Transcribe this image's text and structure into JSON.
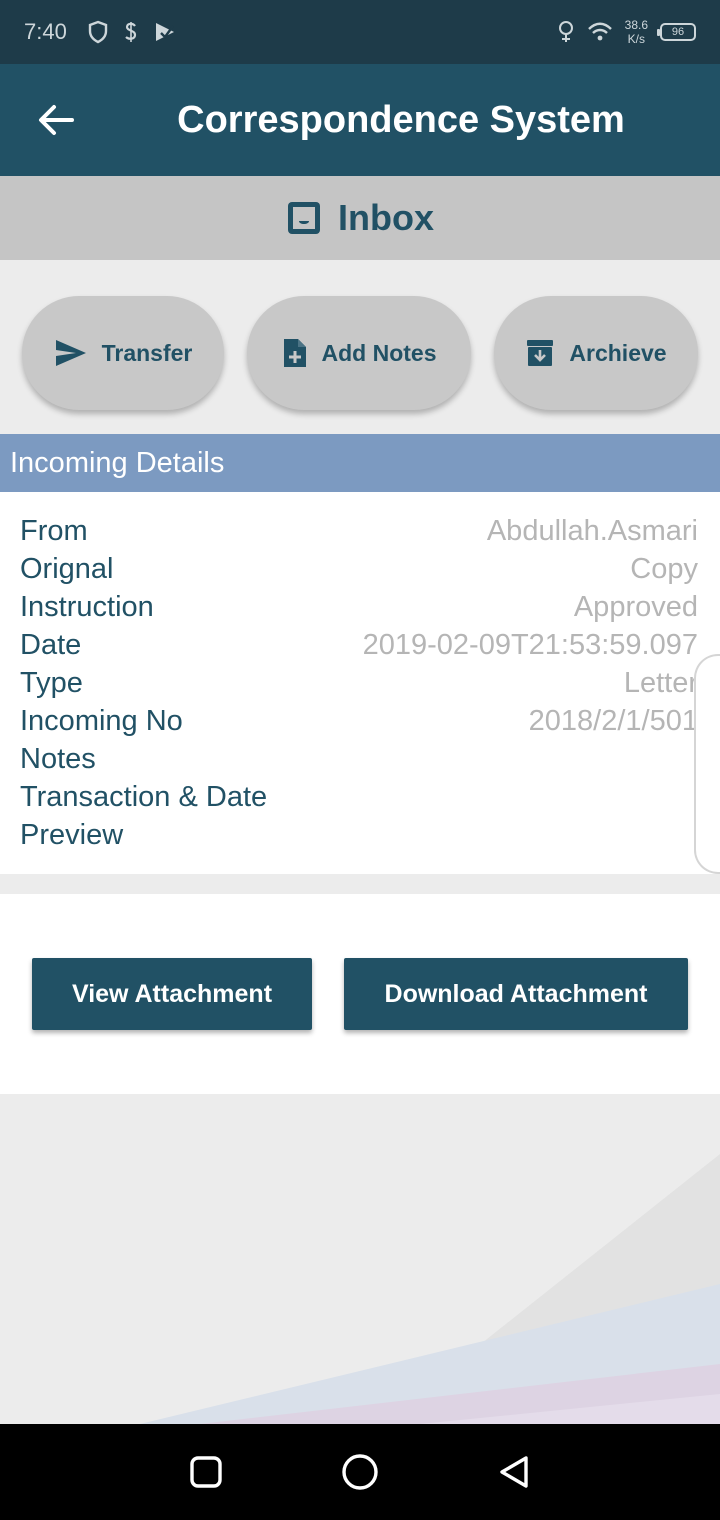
{
  "status_bar": {
    "time": "7:40",
    "net_speed_value": "38.6",
    "net_speed_unit": "K/s",
    "battery": "96"
  },
  "app_bar": {
    "title": "Correspondence System"
  },
  "section": {
    "title": "Inbox"
  },
  "actions": [
    {
      "label": "Transfer",
      "icon": "send-icon"
    },
    {
      "label": "Add Notes",
      "icon": "note-add-icon"
    },
    {
      "label": "Archieve",
      "icon": "archive-icon"
    }
  ],
  "details": {
    "header": "Incoming Details",
    "rows": [
      {
        "label": "From",
        "value": "Abdullah.Asmari"
      },
      {
        "label": "Orignal",
        "value": "Copy"
      },
      {
        "label": "Instruction",
        "value": "Approved"
      },
      {
        "label": "Date",
        "value": "2019-02-09T21:53:59.097"
      },
      {
        "label": "Type",
        "value": "Letter"
      },
      {
        "label": "Incoming No",
        "value": "2018/2/1/501"
      },
      {
        "label": "Notes",
        "value": ""
      },
      {
        "label": "Transaction & Date",
        "value": ""
      },
      {
        "label": "Preview",
        "value": ""
      }
    ]
  },
  "attachments": {
    "view_label": "View Attachment",
    "download_label": "Download Attachment"
  },
  "colors": {
    "primary": "#215165",
    "status_bar": "#1e3b49",
    "details_header": "#7c9ac1",
    "button_bg": "#c8c8c8"
  }
}
